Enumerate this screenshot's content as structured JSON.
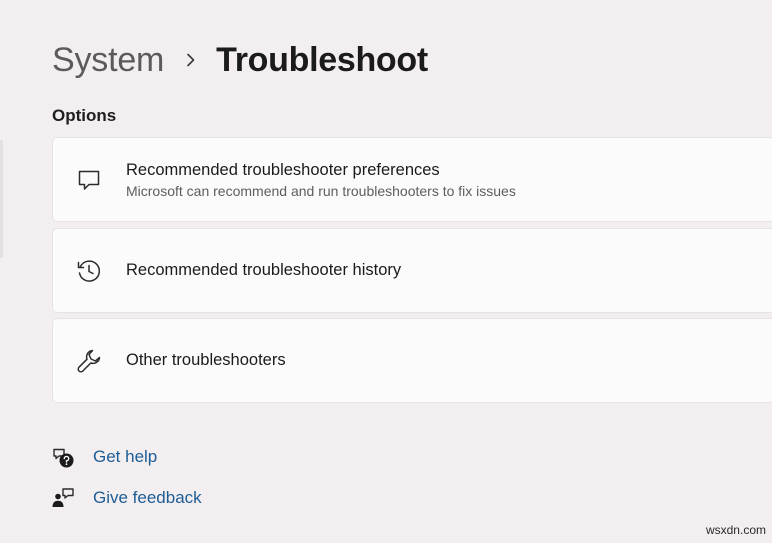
{
  "breadcrumb": {
    "parent": "System",
    "separator_icon": "chevron-right-icon",
    "current": "Troubleshoot"
  },
  "options_section": {
    "title": "Options",
    "items": [
      {
        "icon": "chat-bubble-icon",
        "title": "Recommended troubleshooter preferences",
        "description": "Microsoft can recommend and run troubleshooters to fix issues"
      },
      {
        "icon": "history-icon",
        "title": "Recommended troubleshooter history"
      },
      {
        "icon": "wrench-icon",
        "title": "Other troubleshooters"
      }
    ]
  },
  "links": [
    {
      "icon": "get-help-icon",
      "label": "Get help"
    },
    {
      "icon": "give-feedback-icon",
      "label": "Give feedback"
    }
  ],
  "watermark": "wsxdn.com",
  "colors": {
    "background": "#f3eef0",
    "card": "#fcfbfb",
    "link": "#1d5d96"
  }
}
